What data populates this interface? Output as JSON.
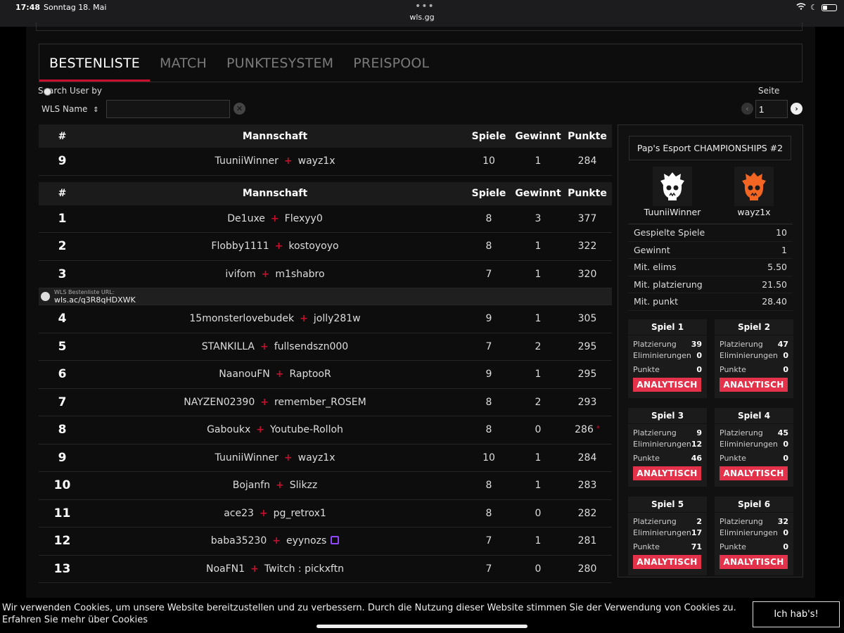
{
  "status_bar": {
    "time": "17:48",
    "date": "Sonntag 18. Mai",
    "url": "wls.gg"
  },
  "tabs": [
    "BESTENLISTE",
    "MATCH",
    "PUNKTESYSTEM",
    "PREISPOOL"
  ],
  "search": {
    "label": "Search User by",
    "select_value": "WLS Name",
    "input_value": ""
  },
  "pager": {
    "label": "Seite",
    "value": "1"
  },
  "table": {
    "headers": {
      "rank": "#",
      "team": "Mannschaft",
      "spiele": "Spiele",
      "gewinnt": "Gewinnt",
      "punkte": "Punkte"
    },
    "highlight_row": {
      "rank": "9",
      "p1": "TuuniiWinner",
      "p2": "wayz1x",
      "spiele": "10",
      "gewinnt": "1",
      "punkte": "284"
    },
    "rows": [
      {
        "rank": "1",
        "p1": "De1uxe",
        "p2": "Flexyy0",
        "spiele": "8",
        "gewinnt": "3",
        "punkte": "377"
      },
      {
        "rank": "2",
        "p1": "Flobby1111",
        "p2": "kostoyoyo",
        "spiele": "8",
        "gewinnt": "1",
        "punkte": "322"
      },
      {
        "rank": "3",
        "p1": "ivifom",
        "p2": "m1shabro",
        "spiele": "7",
        "gewinnt": "1",
        "punkte": "320"
      },
      {
        "rank": "4",
        "p1": "15monsterlovebudek",
        "p2": "jolly281w",
        "spiele": "9",
        "gewinnt": "1",
        "punkte": "305"
      },
      {
        "rank": "5",
        "p1": "STANKILLA",
        "p2": "fullsendszn000",
        "spiele": "7",
        "gewinnt": "2",
        "punkte": "295"
      },
      {
        "rank": "6",
        "p1": "NaanouFN",
        "p2": "RaptooR",
        "spiele": "9",
        "gewinnt": "1",
        "punkte": "295"
      },
      {
        "rank": "7",
        "p1": "NAYZEN02390",
        "p2": "remember_ROSEM",
        "spiele": "8",
        "gewinnt": "2",
        "punkte": "293"
      },
      {
        "rank": "8",
        "p1": "Gaboukx",
        "p2": "Youtube-Rolloh",
        "spiele": "8",
        "gewinnt": "0",
        "punkte": "286"
      },
      {
        "rank": "9",
        "p1": "TuuniiWinner",
        "p2": "wayz1x",
        "spiele": "10",
        "gewinnt": "1",
        "punkte": "284"
      },
      {
        "rank": "10",
        "p1": "Bojanfn",
        "p2": "Slikzz",
        "spiele": "8",
        "gewinnt": "1",
        "punkte": "283"
      },
      {
        "rank": "11",
        "p1": "ace23",
        "p2": "pg_retrox1",
        "spiele": "8",
        "gewinnt": "0",
        "punkte": "282"
      },
      {
        "rank": "12",
        "p1": "baba35230",
        "p2": "eyynozs",
        "spiele": "7",
        "gewinnt": "1",
        "punkte": "281"
      },
      {
        "rank": "13",
        "p1": "NoaFN1",
        "p2": "Twitch : pickxftn",
        "spiele": "7",
        "gewinnt": "0",
        "punkte": "280"
      }
    ],
    "flag_mark": "*",
    "url_row": {
      "caption": "WLS Bestenliste URL:",
      "url": "wls.ac/q3R8qHDXWK"
    }
  },
  "panel": {
    "title": "Pap's Esport CHAMPIONSHIPS #2",
    "player1": "TuuniiWinner",
    "player2": "wayz1x",
    "avatar_colors": {
      "player1": "#ffffff",
      "player2": "#f26522"
    },
    "stats": [
      {
        "label": "Gespielte Spiele",
        "value": "10"
      },
      {
        "label": "Gewinnt",
        "value": "1"
      },
      {
        "label": "Mit. elims",
        "value": "5.50"
      },
      {
        "label": "Mit. platzierung",
        "value": "21.50"
      },
      {
        "label": "Mit. punkt",
        "value": "28.40"
      }
    ],
    "game_labels": {
      "platz": "Platzierung",
      "elim": "Eliminierungen",
      "punkte": "Punkte",
      "button": "ANALYTISCH"
    },
    "games": [
      {
        "title": "Spiel 1",
        "platz": "39",
        "elim": "0",
        "punkte": "0"
      },
      {
        "title": "Spiel 2",
        "platz": "47",
        "elim": "0",
        "punkte": "0"
      },
      {
        "title": "Spiel 3",
        "platz": "9",
        "elim": "12",
        "punkte": "46"
      },
      {
        "title": "Spiel 4",
        "platz": "45",
        "elim": "0",
        "punkte": "0"
      },
      {
        "title": "Spiel 5",
        "platz": "2",
        "elim": "17",
        "punkte": "71"
      },
      {
        "title": "Spiel 6",
        "platz": "32",
        "elim": "0",
        "punkte": "0"
      }
    ]
  },
  "cookie": {
    "text": "Wir verwenden Cookies, um unsere Website bereitzustellen und zu verbessern. Durch die Nutzung dieser Website stimmen Sie der Verwendung von Cookies zu. Erfahren Sie mehr über Cookies",
    "button": "Ich hab's!"
  },
  "colors": {
    "accent": "#c8102e",
    "button": "#e3324a",
    "twitch": "#9146ff"
  }
}
